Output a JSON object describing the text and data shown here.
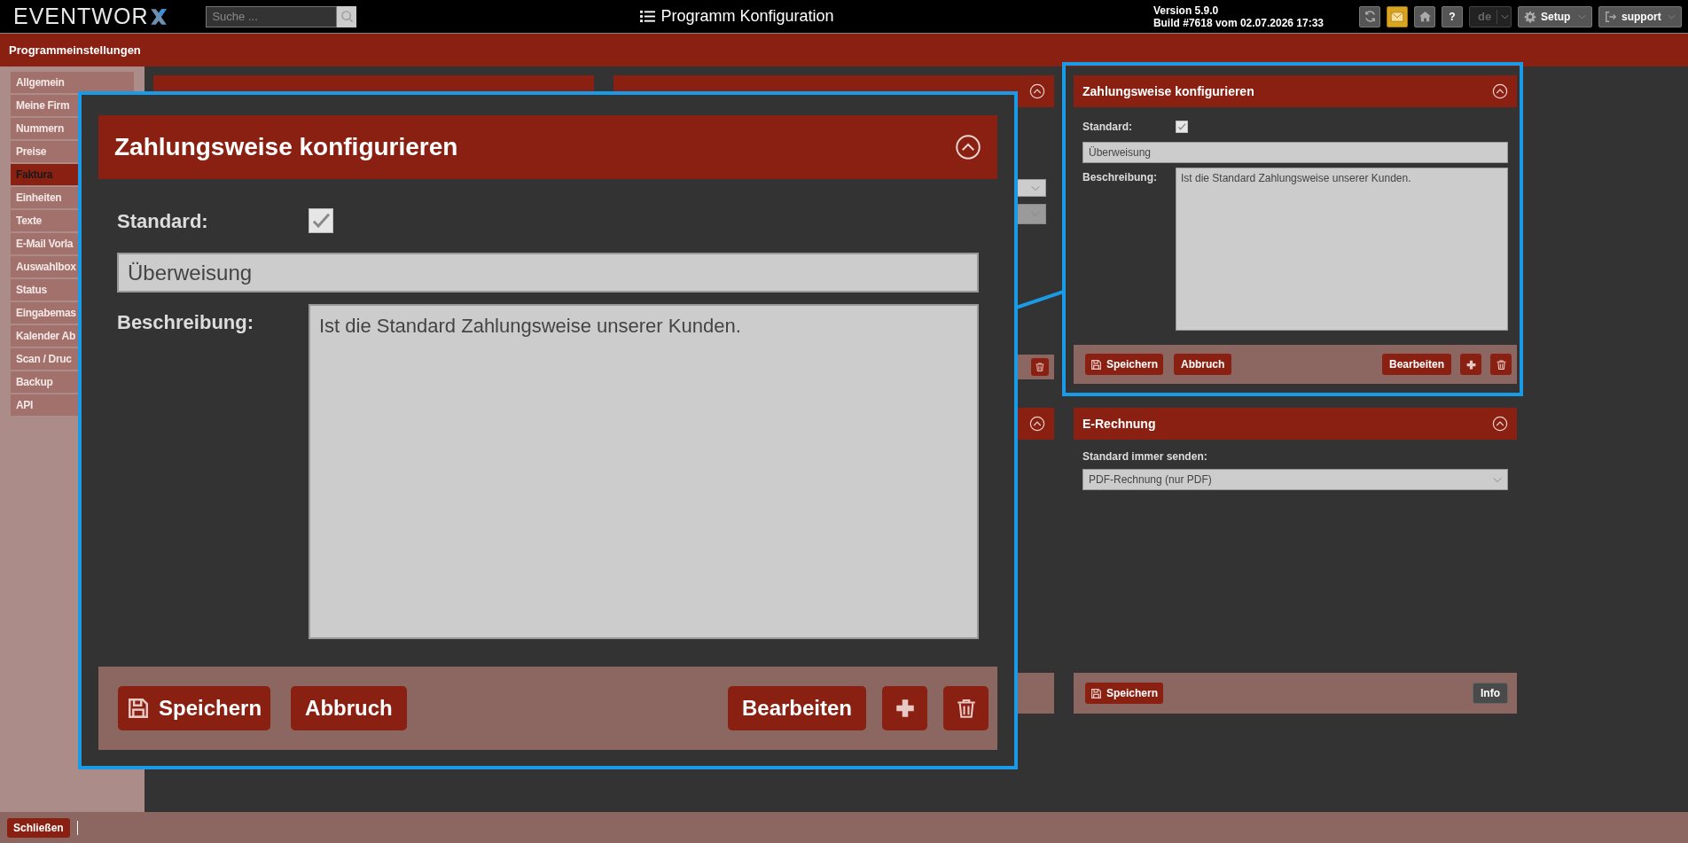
{
  "header": {
    "logo": "EVENTWOR",
    "search": {
      "placeholder": "Suche ..."
    },
    "title": "Programm Konfiguration",
    "version": "Version 5.9.0",
    "build": "Build #7618 vom 02.07.2026 17:33",
    "toolbar": [
      {
        "kind": "refresh",
        "highlighted": false
      },
      {
        "kind": "mail",
        "highlighted": true
      },
      {
        "kind": "home",
        "highlighted": false
      },
      {
        "kind": "help",
        "label": "?",
        "highlighted": false
      }
    ],
    "language": {
      "value": "de"
    },
    "menus": [
      {
        "kind": "settings",
        "label": "Setup"
      },
      {
        "kind": "logout",
        "label": "support"
      }
    ]
  },
  "page_title": "Programmeinstellungen",
  "sidebar": {
    "items": [
      {
        "label": "Allgemein",
        "selected": false
      },
      {
        "label": "Meine Firm",
        "selected": false
      },
      {
        "label": "Nummern",
        "selected": false
      },
      {
        "label": "Preise",
        "selected": false
      },
      {
        "label": "Faktura",
        "selected": true
      },
      {
        "label": "Einheiten",
        "selected": false
      },
      {
        "label": "Texte",
        "selected": false
      },
      {
        "label": "E-Mail Vorla",
        "selected": false
      },
      {
        "label": "Auswahlbox",
        "selected": false
      },
      {
        "label": "Status",
        "selected": false
      },
      {
        "label": "Eingabemas",
        "selected": false
      },
      {
        "label": "Kalender Ab",
        "selected": false
      },
      {
        "label": "Scan / Druc",
        "selected": false
      },
      {
        "label": "Backup",
        "selected": false
      },
      {
        "label": "API",
        "selected": false
      }
    ]
  },
  "zahlungsweise": {
    "title": "Zahlungsweise konfigurieren",
    "standard_label": "Standard:",
    "standard_checked": true,
    "name_value": "Überweisung",
    "description_label": "Beschreibung:",
    "description_value": "Ist die Standard Zahlungsweise unserer Kunden.",
    "buttons_left": [
      {
        "kind": "save",
        "label": "Speichern"
      },
      {
        "kind": "text",
        "label": "Abbruch"
      }
    ],
    "buttons_right": [
      {
        "kind": "text",
        "label": "Bearbeiten"
      },
      {
        "kind": "add"
      },
      {
        "kind": "delete"
      }
    ]
  },
  "e_rechnung": {
    "title": "E-Rechnung",
    "label": "Standard immer senden:",
    "value": "PDF-Rechnung (nur PDF)",
    "buttons_left": [
      {
        "kind": "save",
        "label": "Speichern"
      }
    ],
    "buttons_right": [
      {
        "kind": "info",
        "label": "Info"
      }
    ]
  },
  "callout": {
    "title": "Zahlungsweise konfigurieren",
    "standard_label": "Standard:",
    "standard_checked": true,
    "name_value": "Überweisung",
    "description_label": "Beschreibung:",
    "description_value": "Ist die Standard Zahlungsweise unserer Kunden.",
    "buttons_left": [
      {
        "kind": "save",
        "label": "Speichern"
      },
      {
        "kind": "text",
        "label": "Abbruch"
      }
    ],
    "buttons_right": [
      {
        "kind": "text",
        "label": "Bearbeiten"
      },
      {
        "kind": "add"
      },
      {
        "kind": "delete"
      }
    ]
  },
  "footer": {
    "close": "Schließen"
  }
}
